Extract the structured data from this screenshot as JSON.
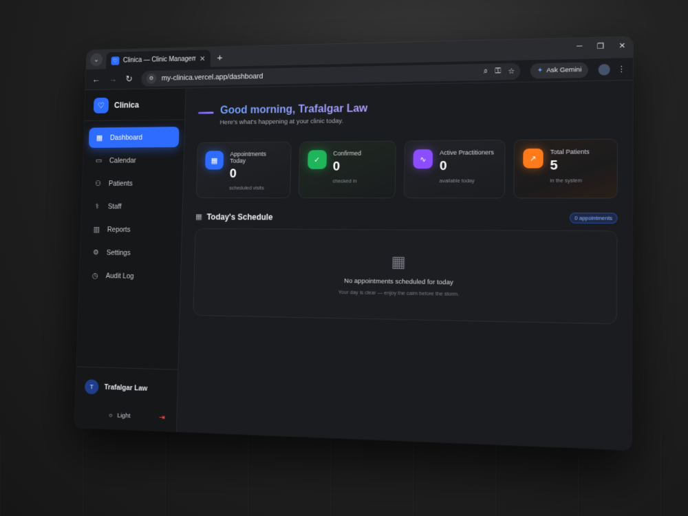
{
  "browser": {
    "tab_title": "Clinica — Clinic Management S",
    "url": "my-clinica.vercel.app/dashboard",
    "gemini_label": "Ask Gemini"
  },
  "brand": {
    "name": "Clinica"
  },
  "sidebar": {
    "items": [
      {
        "label": "Dashboard",
        "icon": "grid-icon",
        "active": true
      },
      {
        "label": "Calendar",
        "icon": "calendar-icon"
      },
      {
        "label": "Patients",
        "icon": "users-icon"
      },
      {
        "label": "Staff",
        "icon": "staff-icon"
      },
      {
        "label": "Reports",
        "icon": "bar-chart-icon"
      },
      {
        "label": "Settings",
        "icon": "gear-icon"
      },
      {
        "label": "Audit Log",
        "icon": "clock-icon"
      }
    ],
    "user": {
      "initial": "T",
      "name": "Trafalgar Law"
    },
    "theme_label": "Light"
  },
  "main": {
    "greeting": "Good morning, Trafalgar Law",
    "subtitle": "Here's what's happening at your clinic today.",
    "stats": [
      {
        "label": "Appointments Today",
        "value": "0",
        "sub": "scheduled visits",
        "color": "#2e6bff",
        "icon": "calendar-icon"
      },
      {
        "label": "Confirmed",
        "value": "0",
        "sub": "checked in",
        "color": "#1fb55a",
        "icon": "check-circle-icon"
      },
      {
        "label": "Active Practitioners",
        "value": "0",
        "sub": "available today",
        "color": "#8b4dff",
        "icon": "activity-icon"
      },
      {
        "label": "Total Patients",
        "value": "5",
        "sub": "in the system",
        "color": "#ff7a1a",
        "icon": "trend-up-icon"
      }
    ],
    "schedule": {
      "title": "Today's Schedule",
      "badge": "0 appointments",
      "empty_title": "No appointments scheduled for today",
      "empty_sub": "Your day is clear — enjoy the calm before the storm."
    }
  }
}
